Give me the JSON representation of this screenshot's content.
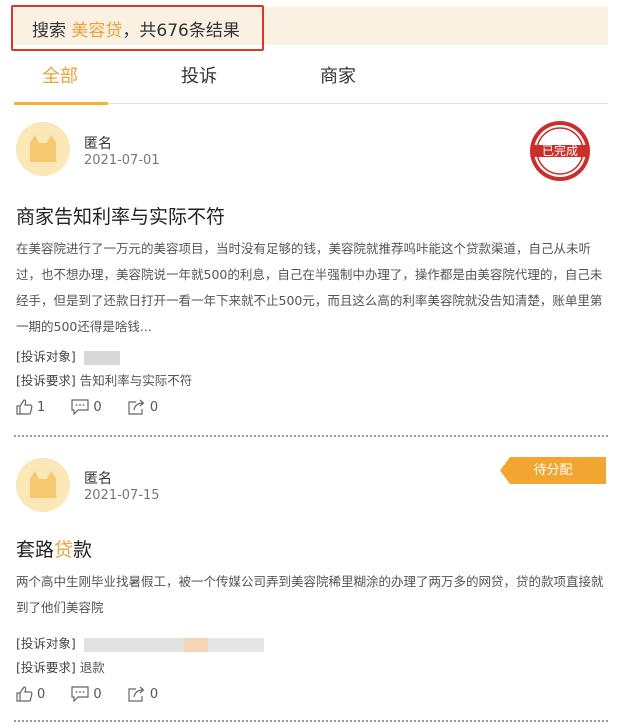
{
  "search": {
    "prefix": "搜索",
    "keyword": "美容贷",
    "suffix": "，共676条结果"
  },
  "tabs": [
    {
      "label": "全部",
      "active": true
    },
    {
      "label": "投诉",
      "active": false
    },
    {
      "label": "商家",
      "active": false
    }
  ],
  "complaints": [
    {
      "author": "匿名",
      "date": "2021-07-01",
      "status": "已完成",
      "title": "商家告知利率与实际不符",
      "body": "在美容院进行了一万元的美容项目，当时没有足够的钱，美容院就推荐呜咔能这个贷款渠道，自己从未听过，也不想办理，美容院说一年就500的利息，自己在半强制中办理了，操作都是由美容院代理的，自己未经手，但是到了还款日打开一看一年下来就不止500元，而且这么高的利率美容院就没告知清楚，账单里第一期的500还得是啥钱...",
      "target_label": "[投诉对象]",
      "demand_label": "[投诉要求]",
      "demand": "告知利率与实际不符",
      "likes": "1",
      "comments": "0",
      "shares": "0"
    },
    {
      "author": "匿名",
      "date": "2021-07-15",
      "status": "待分配",
      "title_pre": "套路",
      "title_hl": "贷",
      "title_post": "款",
      "body": "两个高中生刚毕业找暑假工，被一个传媒公司弄到美容院稀里糊涂的办理了两万多的网贷，贷的款项直接就到了他们美容院",
      "target_label": "[投诉对象]",
      "demand_label": "[投诉要求]",
      "demand": "退款",
      "likes": "0",
      "comments": "0",
      "shares": "0"
    }
  ],
  "colors": {
    "accent": "#e8a23c",
    "highlight_box": "#d9352d",
    "stamp_red": "#c9302c",
    "pending_orange": "#f2a531"
  }
}
